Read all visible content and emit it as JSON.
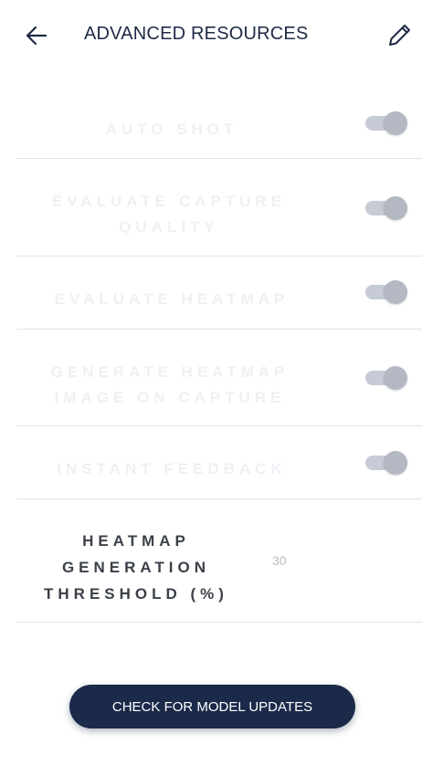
{
  "header": {
    "title": "ADVANCED RESOURCES",
    "back_icon": "arrow-left-icon",
    "edit_icon": "pencil-icon"
  },
  "settings": [
    {
      "label": "AUTO SHOT",
      "enabled": true
    },
    {
      "label": "EVALUATE CAPTURE QUALITY",
      "enabled": true
    },
    {
      "label": "EVALUATE HEATMAP",
      "enabled": true
    },
    {
      "label": "GENERATE HEATMAP IMAGE ON CAPTURE",
      "enabled": true
    },
    {
      "label": "INSTANT FEEDBACK",
      "enabled": true
    }
  ],
  "threshold": {
    "label_lines": [
      "HEATMAP",
      "GENERATION",
      "THRESHOLD (%)"
    ],
    "value": "30"
  },
  "actions": {
    "check_updates_label": "CHECK FOR MODEL UPDATES"
  },
  "colors": {
    "primary": "#1c2a4a",
    "toggle_track": "#c6cbd6",
    "toggle_knob": "#b3b8c2"
  }
}
